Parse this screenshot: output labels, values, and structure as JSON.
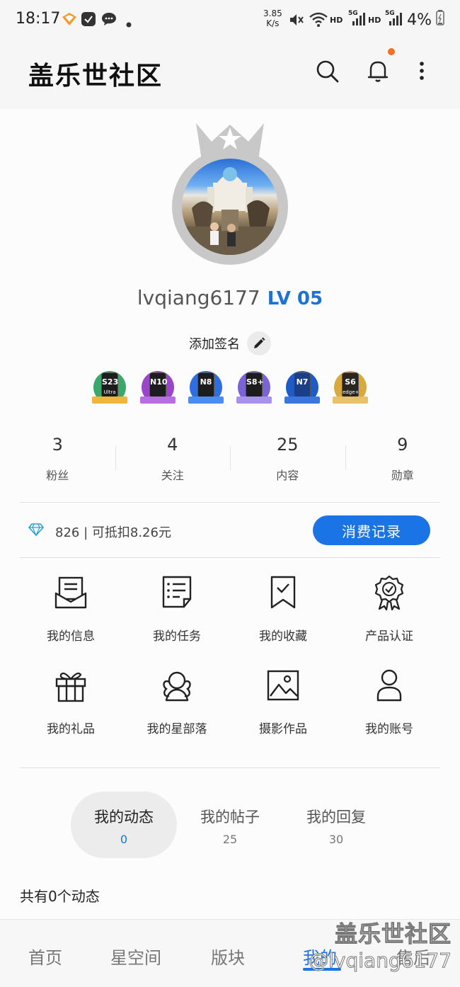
{
  "status_bar": {
    "time": "18:17",
    "net_speed_value": "3.85",
    "net_speed_unit": "K/s",
    "hd1": "HD",
    "hd2": "HD",
    "gen1": "5G",
    "gen2": "5G",
    "battery": "4%"
  },
  "app_bar": {
    "title": "盖乐世社区",
    "icons": [
      "search-icon",
      "bell-icon",
      "more-vertical-icon"
    ],
    "notification_dot_color": "#f37021"
  },
  "profile": {
    "username": "lvqiang6177",
    "level": "LV 05",
    "signature_label": "添加签名",
    "badges": [
      {
        "model": "S23",
        "sub": "Ultra",
        "color": "#3aa86b"
      },
      {
        "model": "N10",
        "sub": "",
        "color": "#9b46c8"
      },
      {
        "model": "N8",
        "sub": "",
        "color": "#2f6ee0"
      },
      {
        "model": "S8+",
        "sub": "",
        "color": "#7b63d6"
      },
      {
        "model": "N7",
        "sub": "",
        "color": "#1f5bc6"
      },
      {
        "model": "S6",
        "sub": "edge+",
        "color": "#d9a941"
      }
    ]
  },
  "stats": [
    {
      "count": "3",
      "label": "粉丝"
    },
    {
      "count": "4",
      "label": "关注"
    },
    {
      "count": "25",
      "label": "内容"
    },
    {
      "count": "9",
      "label": "勋章"
    }
  ],
  "points": {
    "text": "826 | 可抵扣8.26元",
    "button": "消费记录"
  },
  "menu": [
    {
      "label": "我的信息",
      "icon": "message-envelope-icon"
    },
    {
      "label": "我的任务",
      "icon": "task-list-icon"
    },
    {
      "label": "我的收藏",
      "icon": "bookmark-check-icon"
    },
    {
      "label": "产品认证",
      "icon": "certified-badge-icon"
    },
    {
      "label": "我的礼品",
      "icon": "gift-icon"
    },
    {
      "label": "我的星部落",
      "icon": "tribe-people-icon"
    },
    {
      "label": "摄影作品",
      "icon": "photo-icon"
    },
    {
      "label": "我的账号",
      "icon": "account-icon"
    }
  ],
  "tabs": [
    {
      "label": "我的动态",
      "count": "0"
    },
    {
      "label": "我的帖子",
      "count": "25"
    },
    {
      "label": "我的回复",
      "count": "30"
    }
  ],
  "feed": {
    "total": "共有0个动态"
  },
  "bottom_nav": [
    {
      "label": "首页"
    },
    {
      "label": "星空间"
    },
    {
      "label": "版块"
    },
    {
      "label": "我的"
    },
    {
      "label": "售后"
    }
  ],
  "watermark": {
    "brand": "盖乐世社区",
    "user": "@lvqiang6177"
  }
}
